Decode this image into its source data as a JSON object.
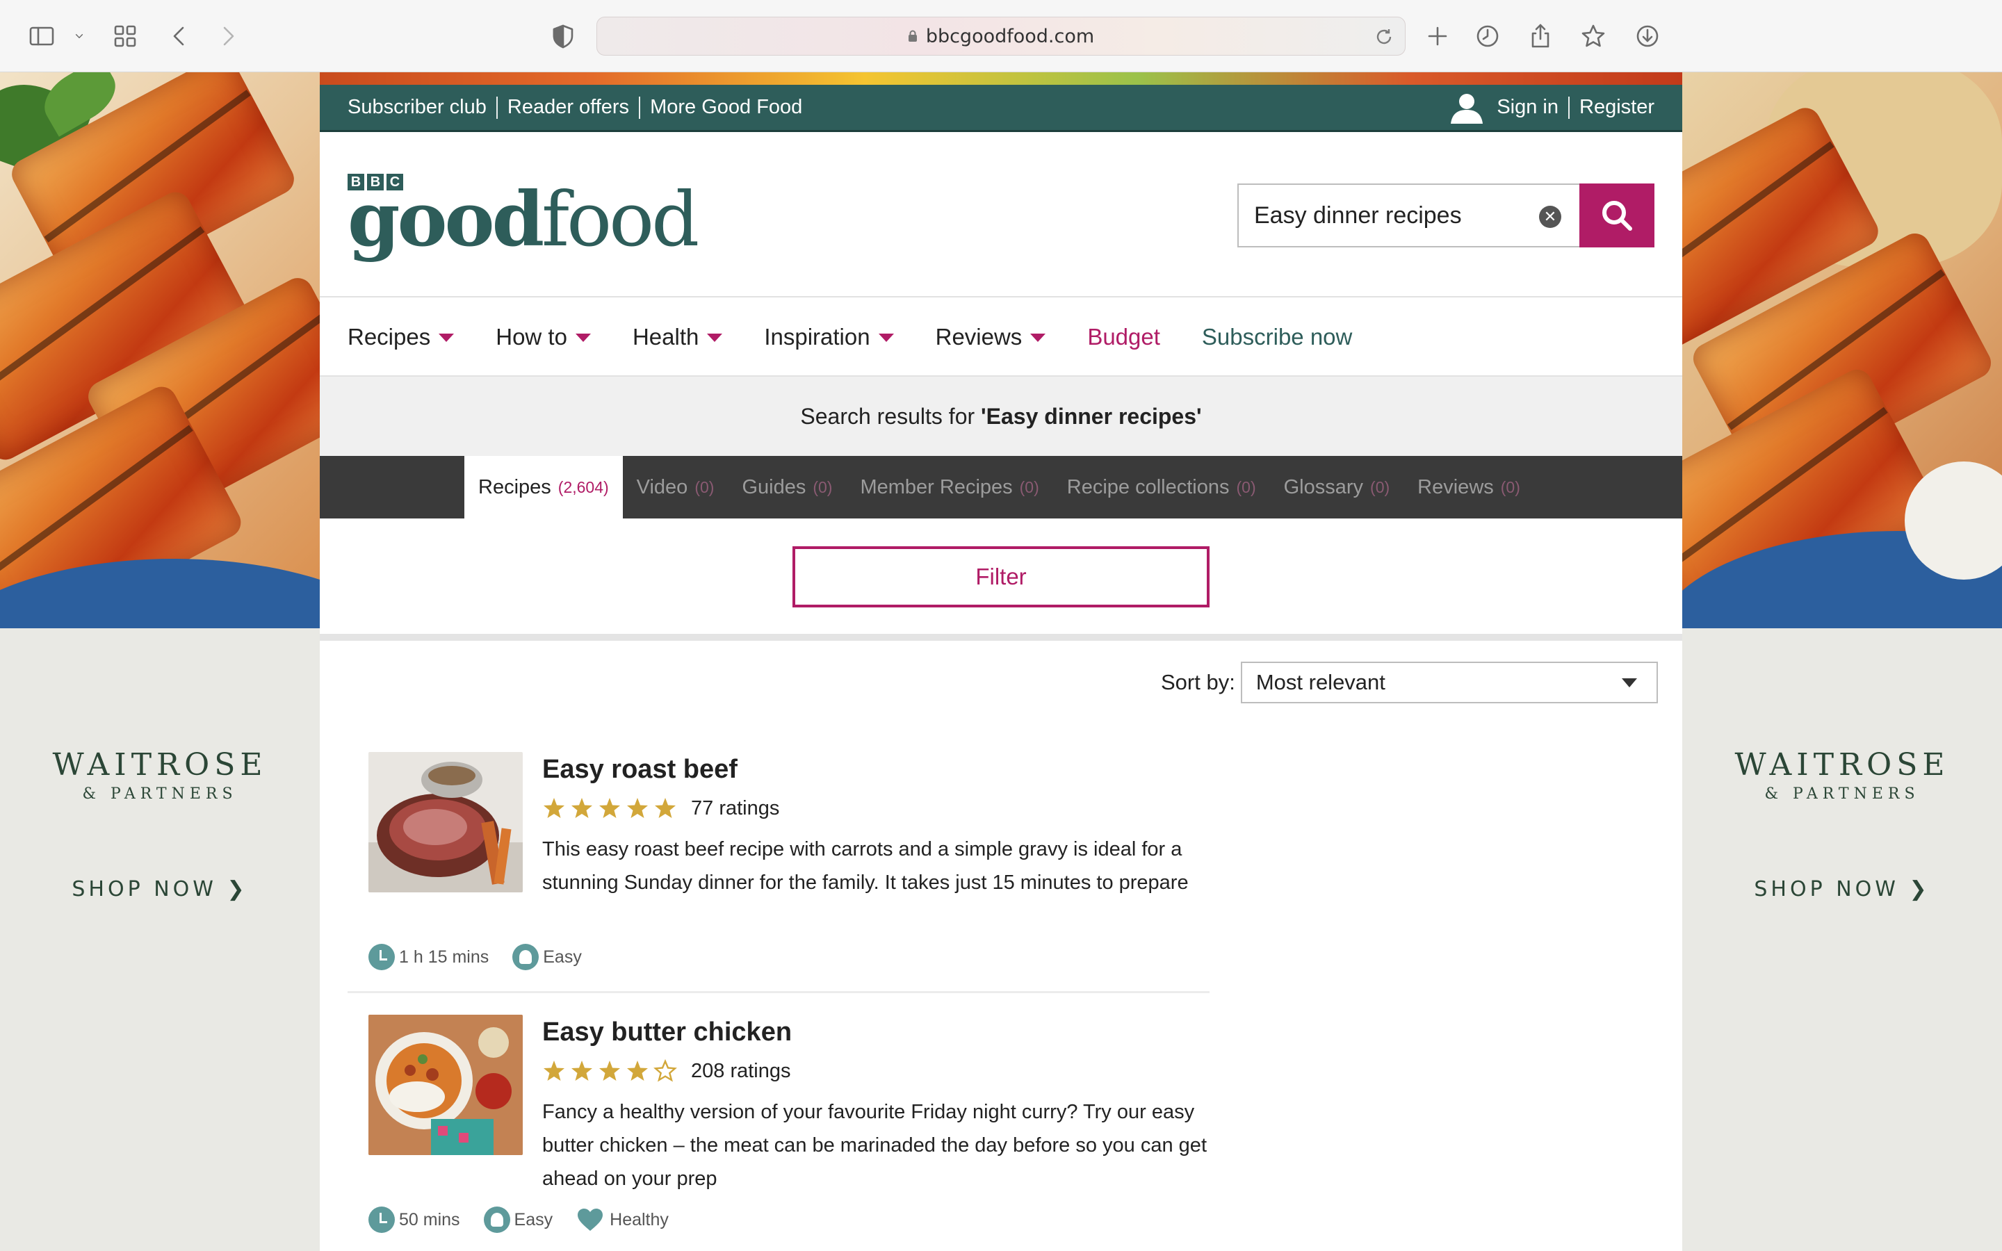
{
  "browser": {
    "url": "bbcgoodfood.com"
  },
  "ad": {
    "brand": "WAITROSE",
    "sub": "& PARTNERS",
    "cta": "SHOP NOW"
  },
  "topbar": {
    "links": [
      "Subscriber club",
      "Reader offers",
      "More Good Food"
    ],
    "sign_in": "Sign in",
    "register": "Register"
  },
  "logo": {
    "bbc": [
      "B",
      "B",
      "C"
    ],
    "good": "good",
    "food": "food"
  },
  "search": {
    "value": "Easy dinner recipes"
  },
  "nav": {
    "items": [
      "Recipes",
      "How to",
      "Health",
      "Inspiration",
      "Reviews"
    ],
    "budget": "Budget",
    "subscribe": "Subscribe now"
  },
  "results": {
    "prefix": "Search results for ",
    "query": "'Easy dinner recipes'"
  },
  "tabs": [
    {
      "label": "Recipes",
      "count": "(2,604)"
    },
    {
      "label": "Video",
      "count": "(0)"
    },
    {
      "label": "Guides",
      "count": "(0)"
    },
    {
      "label": "Member Recipes",
      "count": "(0)"
    },
    {
      "label": "Recipe collections",
      "count": "(0)"
    },
    {
      "label": "Glossary",
      "count": "(0)"
    },
    {
      "label": "Reviews",
      "count": "(0)"
    }
  ],
  "filter_label": "Filter",
  "sort": {
    "label": "Sort by:",
    "value": "Most relevant"
  },
  "recipes": [
    {
      "title": "Easy roast beef",
      "stars": 5,
      "ratings": "77 ratings",
      "desc": "This easy roast beef recipe with carrots and a simple gravy is ideal for a stunning Sunday dinner for the family. It takes just 15 minutes to prepare",
      "time": "1 h 15 mins",
      "difficulty": "Easy"
    },
    {
      "title": "Easy butter chicken",
      "stars": 4,
      "ratings": "208 ratings",
      "desc": "Fancy a healthy version of your favourite Friday night curry? Try our easy butter chicken – the meat can be marinaded the day before so you can get ahead on your prep",
      "time": "50 mins",
      "difficulty": "Easy",
      "tag": "Healthy"
    }
  ],
  "colors": {
    "brand_green": "#2e5d5a",
    "brand_pink": "#b01c66",
    "star": "#d2a73a"
  }
}
